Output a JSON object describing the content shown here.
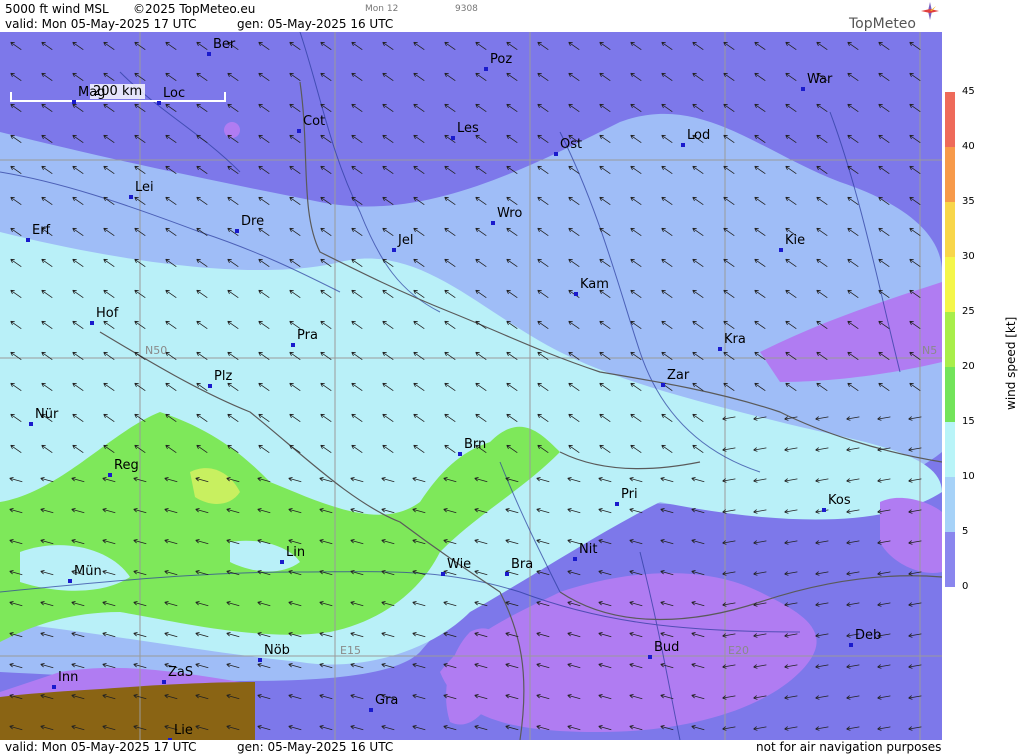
{
  "header": {
    "title": "5000 ft wind MSL",
    "copyright": "©2025 TopMeteo.eu",
    "model": "Mon 12",
    "code": "9308",
    "valid": "valid:  Mon  05-May-2025  17 UTC",
    "gen": "gen: 05-May-2025 16 UTC",
    "logo": "TopMeteo"
  },
  "footer": {
    "valid": "valid:  Mon  05-May-2025  17 UTC",
    "gen": "gen: 05-May-2025 16 UTC",
    "disclaimer": "not for air navigation purposes"
  },
  "map": {
    "scale_label": "200 km",
    "grid_labels": {
      "n50_left": "N50",
      "n50_right": "N5",
      "e15": "E15",
      "e20": "E20"
    },
    "cities": [
      {
        "name": "Ber"
      },
      {
        "name": "Poz"
      },
      {
        "name": "War"
      },
      {
        "name": "Mag"
      },
      {
        "name": "Loc"
      },
      {
        "name": "Cot"
      },
      {
        "name": "Les"
      },
      {
        "name": "Ost"
      },
      {
        "name": "Lod"
      },
      {
        "name": "Lei"
      },
      {
        "name": "Wro"
      },
      {
        "name": "Erf"
      },
      {
        "name": "Dre"
      },
      {
        "name": "Jel"
      },
      {
        "name": "Kie"
      },
      {
        "name": "Kam"
      },
      {
        "name": "Hof"
      },
      {
        "name": "Pra"
      },
      {
        "name": "Kra"
      },
      {
        "name": "Zar"
      },
      {
        "name": "Plz"
      },
      {
        "name": "Nür"
      },
      {
        "name": "Brn"
      },
      {
        "name": "Reg"
      },
      {
        "name": "Pri"
      },
      {
        "name": "Kos"
      },
      {
        "name": "Nit"
      },
      {
        "name": "Lin"
      },
      {
        "name": "Wie"
      },
      {
        "name": "Bra"
      },
      {
        "name": "Mün"
      },
      {
        "name": "Deb"
      },
      {
        "name": "Nöb"
      },
      {
        "name": "Bud"
      },
      {
        "name": "Inn"
      },
      {
        "name": "ZaS"
      },
      {
        "name": "Gra"
      },
      {
        "name": "Lie"
      }
    ]
  },
  "legend": {
    "title": "wind  speed  [kt]",
    "ticks": [
      "45",
      "40",
      "35",
      "30",
      "25",
      "20",
      "15",
      "10",
      "5",
      "0"
    ],
    "colors": [
      "#ee6a5a",
      "#f79a4a",
      "#f8d64a",
      "#f4f64a",
      "#a8ee4a",
      "#72e45a",
      "#b8f4f8",
      "#a6d2f8",
      "#8a86ee",
      "#b482f2"
    ]
  },
  "colors": {
    "wind_lt5": "#b07cf2",
    "wind_5_10": "#7d78ea",
    "wind_10_15": "#9fbdf7",
    "wind_15_20": "#b9f0f8",
    "wind_20_25": "#7ee85a",
    "wind_25_30": "#c8f060",
    "terrain": "#8a6414"
  }
}
